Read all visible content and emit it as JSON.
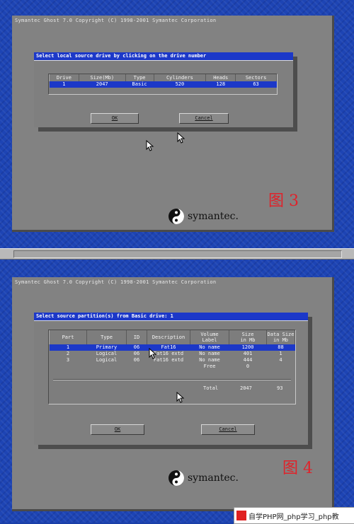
{
  "copyright": "Symantec Ghost 7.0   Copyright (C) 1998-2001 Symantec Corporation",
  "dialog1": {
    "title": "Select local source drive by clicking on the drive number",
    "columns": [
      "Drive",
      "Size(Mb)",
      "Type",
      "Cylinders",
      "Heads",
      "Sectors"
    ],
    "rows": [
      [
        "1",
        "2047",
        "Basic",
        "520",
        "128",
        "63"
      ]
    ],
    "ok_label": "OK",
    "cancel_label": "Cancel"
  },
  "dialog2": {
    "title": "Select source partition(s) from Basic drive: 1",
    "columns": [
      "Part",
      "Type",
      "ID",
      "Description",
      "Volume\nLabel",
      "Size\nin Mb",
      "Data Size\nin Mb"
    ],
    "rows": [
      [
        "1",
        "Primary",
        "06",
        "Fat16",
        "No name",
        "1200",
        "88"
      ],
      [
        "2",
        "Logical",
        "06",
        "Fat16 extd",
        "No name",
        "401",
        "1"
      ],
      [
        "3",
        "Logical",
        "06",
        "Fat16 extd",
        "No name",
        "444",
        "4"
      ],
      [
        "",
        "",
        "",
        "",
        "Free",
        "0",
        ""
      ]
    ],
    "total_label": "Total",
    "total_size": "2047",
    "total_data": "93",
    "ok_label": "OK",
    "cancel_label": "Cancel"
  },
  "figure1_label": "图 3",
  "figure2_label": "图 4",
  "brand": "symantec.",
  "watermark_text": "自学PHP网_php学习_php教",
  "colors": {
    "desktop": "#1d44b4",
    "window": "#828282",
    "titlebar": "#1c38c8",
    "figure_label": "#e0222a"
  }
}
